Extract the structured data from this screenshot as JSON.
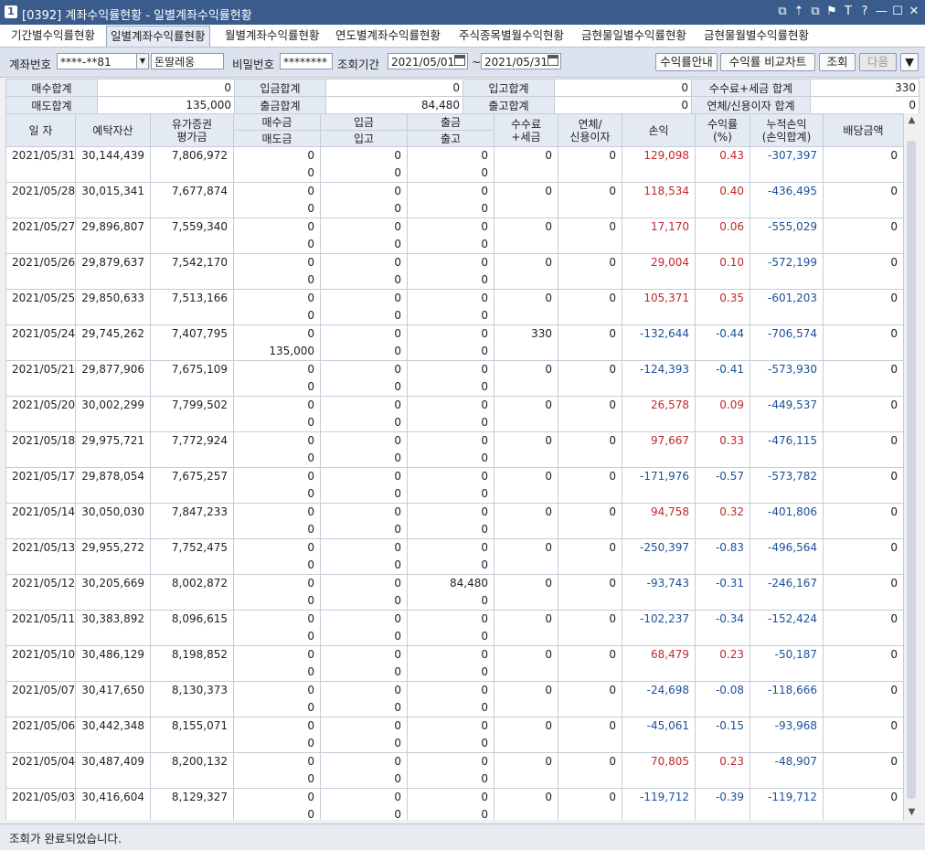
{
  "window": {
    "num": "1",
    "title": "[0392] 계좌수익률현황 - 일별계좌수익률현황",
    "controls": [
      "⧉",
      "⇡",
      "⧉",
      "⚑",
      "T",
      "?",
      "—",
      "☐",
      "✕"
    ]
  },
  "tabs": [
    "기간별수익률현황",
    "일별계좌수익률현황",
    "월별계좌수익률현황",
    "연도별계좌수익률현황",
    "주식종목별월수익현황",
    "금현물일별수익률현황",
    "금현물월별수익률현황"
  ],
  "toolbar": {
    "account_label": "계좌번호",
    "account_value": "****-**81",
    "account_name": "돈딸레옹",
    "password_label": "비밀번호",
    "password_value": "********",
    "period_label": "조회기간",
    "date_from": "2021/05/01",
    "tilde": "~",
    "date_to": "2021/05/31",
    "btn_guide": "수익률안내",
    "btn_compare": "수익률 비교차트",
    "btn_query": "조회",
    "btn_next": "다음",
    "menu_arrow": "▼"
  },
  "summary": {
    "row1": [
      "매수합계",
      "0",
      "입금합계",
      "0",
      "입고합계",
      "0",
      "수수료+세금 합계",
      "330"
    ],
    "row2": [
      "매도합계",
      "135,000",
      "출금합계",
      "84,480",
      "출고합계",
      "0",
      "연체/신용이자 합계",
      "0"
    ]
  },
  "columns": {
    "date": "일 자",
    "deposit": "예탁자산",
    "securities": "유가증권\n평가금",
    "buy": "매수금",
    "sell": "매도금",
    "in_money": "입금",
    "in_stock": "입고",
    "out_money": "출금",
    "out_stock": "출고",
    "fee": "수수료\n+세금",
    "interest": "연체/\n신용이자",
    "pnl": "손익",
    "rate": "수익률\n(%)",
    "cum": "누적손익\n(손익합계)",
    "dividend": "배당금액"
  },
  "rows": [
    {
      "date": "2021/05/31",
      "deposit": "30,144,439",
      "sec": "7,806,972",
      "buy": "0",
      "sell": "0",
      "in": "0",
      "instk": "0",
      "out": "0",
      "outstk": "0",
      "fee": "0",
      "int": "0",
      "pnl": "129,098",
      "rate": "0.43",
      "cum": "-307,397",
      "div": "0"
    },
    {
      "date": "2021/05/28",
      "deposit": "30,015,341",
      "sec": "7,677,874",
      "buy": "0",
      "sell": "0",
      "in": "0",
      "instk": "0",
      "out": "0",
      "outstk": "0",
      "fee": "0",
      "int": "0",
      "pnl": "118,534",
      "rate": "0.40",
      "cum": "-436,495",
      "div": "0"
    },
    {
      "date": "2021/05/27",
      "deposit": "29,896,807",
      "sec": "7,559,340",
      "buy": "0",
      "sell": "0",
      "in": "0",
      "instk": "0",
      "out": "0",
      "outstk": "0",
      "fee": "0",
      "int": "0",
      "pnl": "17,170",
      "rate": "0.06",
      "cum": "-555,029",
      "div": "0"
    },
    {
      "date": "2021/05/26",
      "deposit": "29,879,637",
      "sec": "7,542,170",
      "buy": "0",
      "sell": "0",
      "in": "0",
      "instk": "0",
      "out": "0",
      "outstk": "0",
      "fee": "0",
      "int": "0",
      "pnl": "29,004",
      "rate": "0.10",
      "cum": "-572,199",
      "div": "0"
    },
    {
      "date": "2021/05/25",
      "deposit": "29,850,633",
      "sec": "7,513,166",
      "buy": "0",
      "sell": "0",
      "in": "0",
      "instk": "0",
      "out": "0",
      "outstk": "0",
      "fee": "0",
      "int": "0",
      "pnl": "105,371",
      "rate": "0.35",
      "cum": "-601,203",
      "div": "0"
    },
    {
      "date": "2021/05/24",
      "deposit": "29,745,262",
      "sec": "7,407,795",
      "buy": "0",
      "sell": "135,000",
      "in": "0",
      "instk": "0",
      "out": "0",
      "outstk": "0",
      "fee": "330",
      "int": "0",
      "pnl": "-132,644",
      "rate": "-0.44",
      "cum": "-706,574",
      "div": "0"
    },
    {
      "date": "2021/05/21",
      "deposit": "29,877,906",
      "sec": "7,675,109",
      "buy": "0",
      "sell": "0",
      "in": "0",
      "instk": "0",
      "out": "0",
      "outstk": "0",
      "fee": "0",
      "int": "0",
      "pnl": "-124,393",
      "rate": "-0.41",
      "cum": "-573,930",
      "div": "0"
    },
    {
      "date": "2021/05/20",
      "deposit": "30,002,299",
      "sec": "7,799,502",
      "buy": "0",
      "sell": "0",
      "in": "0",
      "instk": "0",
      "out": "0",
      "outstk": "0",
      "fee": "0",
      "int": "0",
      "pnl": "26,578",
      "rate": "0.09",
      "cum": "-449,537",
      "div": "0"
    },
    {
      "date": "2021/05/18",
      "deposit": "29,975,721",
      "sec": "7,772,924",
      "buy": "0",
      "sell": "0",
      "in": "0",
      "instk": "0",
      "out": "0",
      "outstk": "0",
      "fee": "0",
      "int": "0",
      "pnl": "97,667",
      "rate": "0.33",
      "cum": "-476,115",
      "div": "0"
    },
    {
      "date": "2021/05/17",
      "deposit": "29,878,054",
      "sec": "7,675,257",
      "buy": "0",
      "sell": "0",
      "in": "0",
      "instk": "0",
      "out": "0",
      "outstk": "0",
      "fee": "0",
      "int": "0",
      "pnl": "-171,976",
      "rate": "-0.57",
      "cum": "-573,782",
      "div": "0"
    },
    {
      "date": "2021/05/14",
      "deposit": "30,050,030",
      "sec": "7,847,233",
      "buy": "0",
      "sell": "0",
      "in": "0",
      "instk": "0",
      "out": "0",
      "outstk": "0",
      "fee": "0",
      "int": "0",
      "pnl": "94,758",
      "rate": "0.32",
      "cum": "-401,806",
      "div": "0"
    },
    {
      "date": "2021/05/13",
      "deposit": "29,955,272",
      "sec": "7,752,475",
      "buy": "0",
      "sell": "0",
      "in": "0",
      "instk": "0",
      "out": "0",
      "outstk": "0",
      "fee": "0",
      "int": "0",
      "pnl": "-250,397",
      "rate": "-0.83",
      "cum": "-496,564",
      "div": "0"
    },
    {
      "date": "2021/05/12",
      "deposit": "30,205,669",
      "sec": "8,002,872",
      "buy": "0",
      "sell": "0",
      "in": "0",
      "instk": "0",
      "out": "84,480",
      "outstk": "0",
      "fee": "0",
      "int": "0",
      "pnl": "-93,743",
      "rate": "-0.31",
      "cum": "-246,167",
      "div": "0"
    },
    {
      "date": "2021/05/11",
      "deposit": "30,383,892",
      "sec": "8,096,615",
      "buy": "0",
      "sell": "0",
      "in": "0",
      "instk": "0",
      "out": "0",
      "outstk": "0",
      "fee": "0",
      "int": "0",
      "pnl": "-102,237",
      "rate": "-0.34",
      "cum": "-152,424",
      "div": "0"
    },
    {
      "date": "2021/05/10",
      "deposit": "30,486,129",
      "sec": "8,198,852",
      "buy": "0",
      "sell": "0",
      "in": "0",
      "instk": "0",
      "out": "0",
      "outstk": "0",
      "fee": "0",
      "int": "0",
      "pnl": "68,479",
      "rate": "0.23",
      "cum": "-50,187",
      "div": "0"
    },
    {
      "date": "2021/05/07",
      "deposit": "30,417,650",
      "sec": "8,130,373",
      "buy": "0",
      "sell": "0",
      "in": "0",
      "instk": "0",
      "out": "0",
      "outstk": "0",
      "fee": "0",
      "int": "0",
      "pnl": "-24,698",
      "rate": "-0.08",
      "cum": "-118,666",
      "div": "0"
    },
    {
      "date": "2021/05/06",
      "deposit": "30,442,348",
      "sec": "8,155,071",
      "buy": "0",
      "sell": "0",
      "in": "0",
      "instk": "0",
      "out": "0",
      "outstk": "0",
      "fee": "0",
      "int": "0",
      "pnl": "-45,061",
      "rate": "-0.15",
      "cum": "-93,968",
      "div": "0"
    },
    {
      "date": "2021/05/04",
      "deposit": "30,487,409",
      "sec": "8,200,132",
      "buy": "0",
      "sell": "0",
      "in": "0",
      "instk": "0",
      "out": "0",
      "outstk": "0",
      "fee": "0",
      "int": "0",
      "pnl": "70,805",
      "rate": "0.23",
      "cum": "-48,907",
      "div": "0"
    },
    {
      "date": "2021/05/03",
      "deposit": "30,416,604",
      "sec": "8,129,327",
      "buy": "0",
      "sell": "0",
      "in": "0",
      "instk": "0",
      "out": "0",
      "outstk": "0",
      "fee": "0",
      "int": "0",
      "pnl": "-119,712",
      "rate": "-0.39",
      "cum": "-119,712",
      "div": "0"
    }
  ],
  "status": "조회가 완료되었습니다.",
  "colors": {
    "positive": "#c0282d",
    "negative": "#1c4f9a",
    "title_bar": "#3a5c8c"
  }
}
